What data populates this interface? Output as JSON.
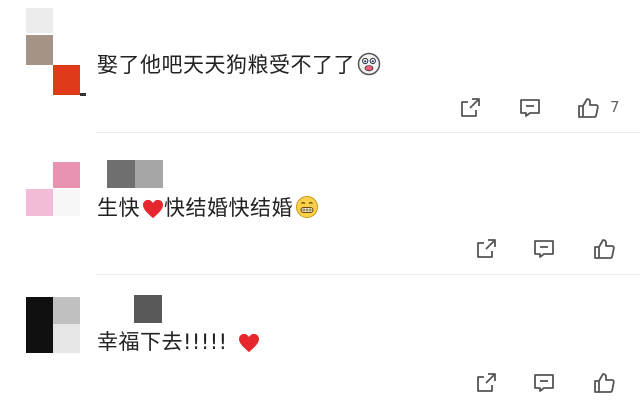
{
  "comments": [
    {
      "text": "娶了他吧天天狗粮受不了了",
      "emoji": "grimacing-face-icon",
      "like_count": "7",
      "colors": {
        "m1": "#ececec",
        "m2": "#a49488",
        "m3": "#e03a1a"
      }
    },
    {
      "text_a": "生快",
      "text_b": "快结婚快结婚",
      "emoji": "grinning-face-icon",
      "heart": "red-heart-icon",
      "colors": {
        "m1": "#e792b0",
        "m2": "#f3bcd6",
        "n1": "#6f6f6f",
        "n2": "#a6a6a6"
      }
    },
    {
      "text": "幸福下去!!!!!",
      "emoji": "red-heart-icon",
      "colors": {
        "m1": "#101010",
        "m2": "#c0c0c0",
        "n1": "#595959"
      }
    }
  ],
  "icons": {
    "share": "share-icon",
    "comment": "comment-icon",
    "like": "thumbs-up-icon"
  }
}
